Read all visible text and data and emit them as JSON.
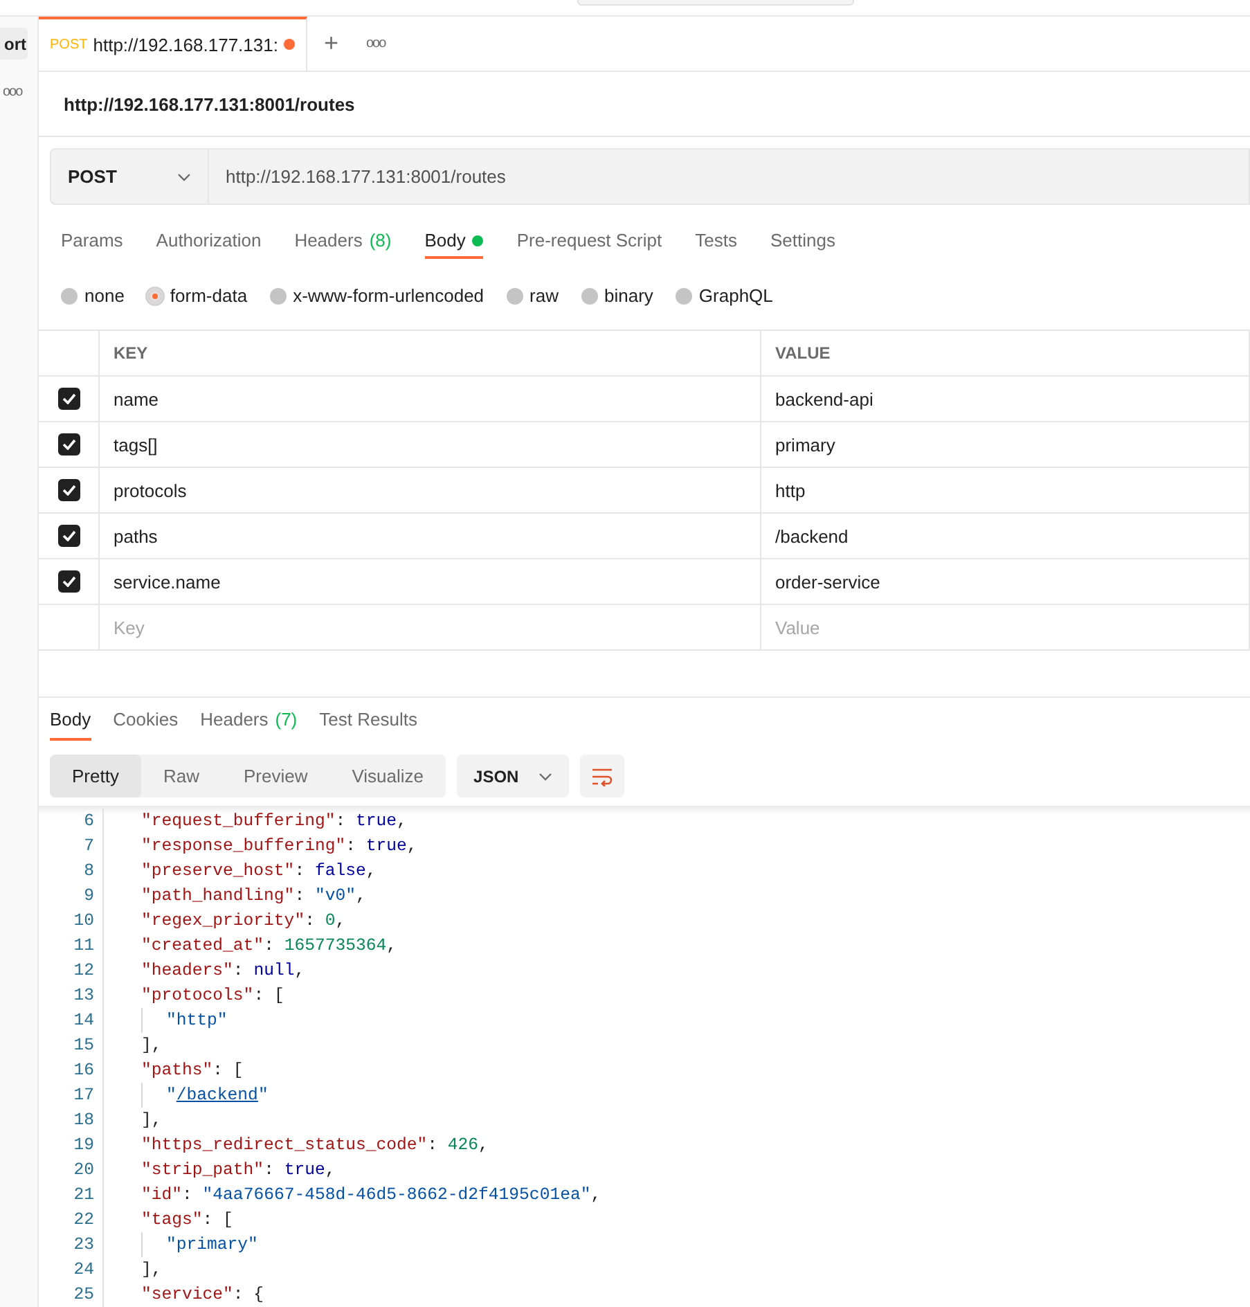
{
  "sidebar": {
    "button": "ort",
    "more": "ooo"
  },
  "request_tabs": [
    {
      "method": "POST",
      "title": "http://192.168.177.131:",
      "unsaved": true,
      "selected": true
    }
  ],
  "tab_actions": {
    "add": "+",
    "more": "ooo"
  },
  "request_title": "http://192.168.177.131:8001/routes",
  "method": "POST",
  "url": "http://192.168.177.131:8001/routes",
  "options_tabs": [
    {
      "label": "Params",
      "selected": false
    },
    {
      "label": "Authorization",
      "selected": false
    },
    {
      "label": "Headers",
      "count": "(8)",
      "selected": false
    },
    {
      "label": "Body",
      "dot": true,
      "selected": true
    },
    {
      "label": "Pre-request Script",
      "selected": false
    },
    {
      "label": "Tests",
      "selected": false
    },
    {
      "label": "Settings",
      "selected": false
    }
  ],
  "body_types": [
    {
      "label": "none",
      "selected": false
    },
    {
      "label": "form-data",
      "selected": true
    },
    {
      "label": "x-www-form-urlencoded",
      "selected": false
    },
    {
      "label": "raw",
      "selected": false
    },
    {
      "label": "binary",
      "selected": false
    },
    {
      "label": "GraphQL",
      "selected": false
    }
  ],
  "form_table": {
    "columns": [
      "KEY",
      "VALUE"
    ],
    "rows": [
      {
        "key": "name",
        "value": "backend-api",
        "checked": true
      },
      {
        "key": "tags[]",
        "value": "primary",
        "checked": true
      },
      {
        "key": "protocols",
        "value": "http",
        "checked": true
      },
      {
        "key": "paths",
        "value": "/backend",
        "checked": true
      },
      {
        "key": "service.name",
        "value": "order-service",
        "checked": true
      }
    ],
    "new_row": {
      "key_placeholder": "Key",
      "value_placeholder": "Value"
    }
  },
  "response_tabs": [
    {
      "label": "Body",
      "selected": true
    },
    {
      "label": "Cookies",
      "selected": false
    },
    {
      "label": "Headers",
      "count": "(7)",
      "selected": false
    },
    {
      "label": "Test Results",
      "selected": false
    }
  ],
  "view_modes": [
    {
      "label": "Pretty",
      "selected": true
    },
    {
      "label": "Raw",
      "selected": false
    },
    {
      "label": "Preview",
      "selected": false
    },
    {
      "label": "Visualize",
      "selected": false
    }
  ],
  "format": "JSON",
  "code_lines": [
    {
      "num": "6",
      "tokens": [
        {
          "kind": "key",
          "text": "\"request_buffering\""
        },
        {
          "kind": "punct",
          "text": ": "
        },
        {
          "kind": "bool",
          "text": "true"
        },
        {
          "kind": "punct",
          "text": ","
        }
      ]
    },
    {
      "num": "7",
      "tokens": [
        {
          "kind": "key",
          "text": "\"response_buffering\""
        },
        {
          "kind": "punct",
          "text": ": "
        },
        {
          "kind": "bool",
          "text": "true"
        },
        {
          "kind": "punct",
          "text": ","
        }
      ]
    },
    {
      "num": "8",
      "tokens": [
        {
          "kind": "key",
          "text": "\"preserve_host\""
        },
        {
          "kind": "punct",
          "text": ": "
        },
        {
          "kind": "bool",
          "text": "false"
        },
        {
          "kind": "punct",
          "text": ","
        }
      ]
    },
    {
      "num": "9",
      "tokens": [
        {
          "kind": "key",
          "text": "\"path_handling\""
        },
        {
          "kind": "punct",
          "text": ": "
        },
        {
          "kind": "string",
          "text": "\"v0\""
        },
        {
          "kind": "punct",
          "text": ","
        }
      ]
    },
    {
      "num": "10",
      "tokens": [
        {
          "kind": "key",
          "text": "\"regex_priority\""
        },
        {
          "kind": "punct",
          "text": ": "
        },
        {
          "kind": "number",
          "text": "0"
        },
        {
          "kind": "punct",
          "text": ","
        }
      ]
    },
    {
      "num": "11",
      "tokens": [
        {
          "kind": "key",
          "text": "\"created_at\""
        },
        {
          "kind": "punct",
          "text": ": "
        },
        {
          "kind": "number",
          "text": "1657735364"
        },
        {
          "kind": "punct",
          "text": ","
        }
      ]
    },
    {
      "num": "12",
      "tokens": [
        {
          "kind": "key",
          "text": "\"headers\""
        },
        {
          "kind": "punct",
          "text": ": "
        },
        {
          "kind": "bool",
          "text": "null"
        },
        {
          "kind": "punct",
          "text": ","
        }
      ]
    },
    {
      "num": "13",
      "tokens": [
        {
          "kind": "key",
          "text": "\"protocols\""
        },
        {
          "kind": "punct",
          "text": ": ["
        }
      ],
      "children": [
        {
          "num": "14",
          "tokens": [
            {
              "kind": "string",
              "text": "\"http\""
            }
          ]
        }
      ]
    },
    {
      "num": "15",
      "tokens": [
        {
          "kind": "punct",
          "text": "],"
        }
      ]
    },
    {
      "num": "16",
      "tokens": [
        {
          "kind": "key",
          "text": "\"paths\""
        },
        {
          "kind": "punct",
          "text": ": ["
        }
      ],
      "children": [
        {
          "num": "17",
          "tokens": [
            {
              "kind": "string",
              "text": "\""
            },
            {
              "kind": "link",
              "text": "/backend"
            },
            {
              "kind": "string",
              "text": "\""
            }
          ]
        }
      ]
    },
    {
      "num": "18",
      "tokens": [
        {
          "kind": "punct",
          "text": "],"
        }
      ]
    },
    {
      "num": "19",
      "tokens": [
        {
          "kind": "key",
          "text": "\"https_redirect_status_code\""
        },
        {
          "kind": "punct",
          "text": ": "
        },
        {
          "kind": "number",
          "text": "426"
        },
        {
          "kind": "punct",
          "text": ","
        }
      ]
    },
    {
      "num": "20",
      "tokens": [
        {
          "kind": "key",
          "text": "\"strip_path\""
        },
        {
          "kind": "punct",
          "text": ": "
        },
        {
          "kind": "bool",
          "text": "true"
        },
        {
          "kind": "punct",
          "text": ","
        }
      ]
    },
    {
      "num": "21",
      "tokens": [
        {
          "kind": "key",
          "text": "\"id\""
        },
        {
          "kind": "punct",
          "text": ": "
        },
        {
          "kind": "string",
          "text": "\"4aa76667-458d-46d5-8662-d2f4195c01ea\""
        },
        {
          "kind": "punct",
          "text": ","
        }
      ]
    },
    {
      "num": "22",
      "tokens": [
        {
          "kind": "key",
          "text": "\"tags\""
        },
        {
          "kind": "punct",
          "text": ": ["
        }
      ],
      "children": [
        {
          "num": "23",
          "tokens": [
            {
              "kind": "string",
              "text": "\"primary\""
            }
          ]
        }
      ]
    },
    {
      "num": "24",
      "tokens": [
        {
          "kind": "punct",
          "text": "],"
        }
      ]
    },
    {
      "num": "25",
      "tokens": [
        {
          "kind": "key",
          "text": "\"service\""
        },
        {
          "kind": "punct",
          "text": ": {"
        }
      ]
    }
  ]
}
